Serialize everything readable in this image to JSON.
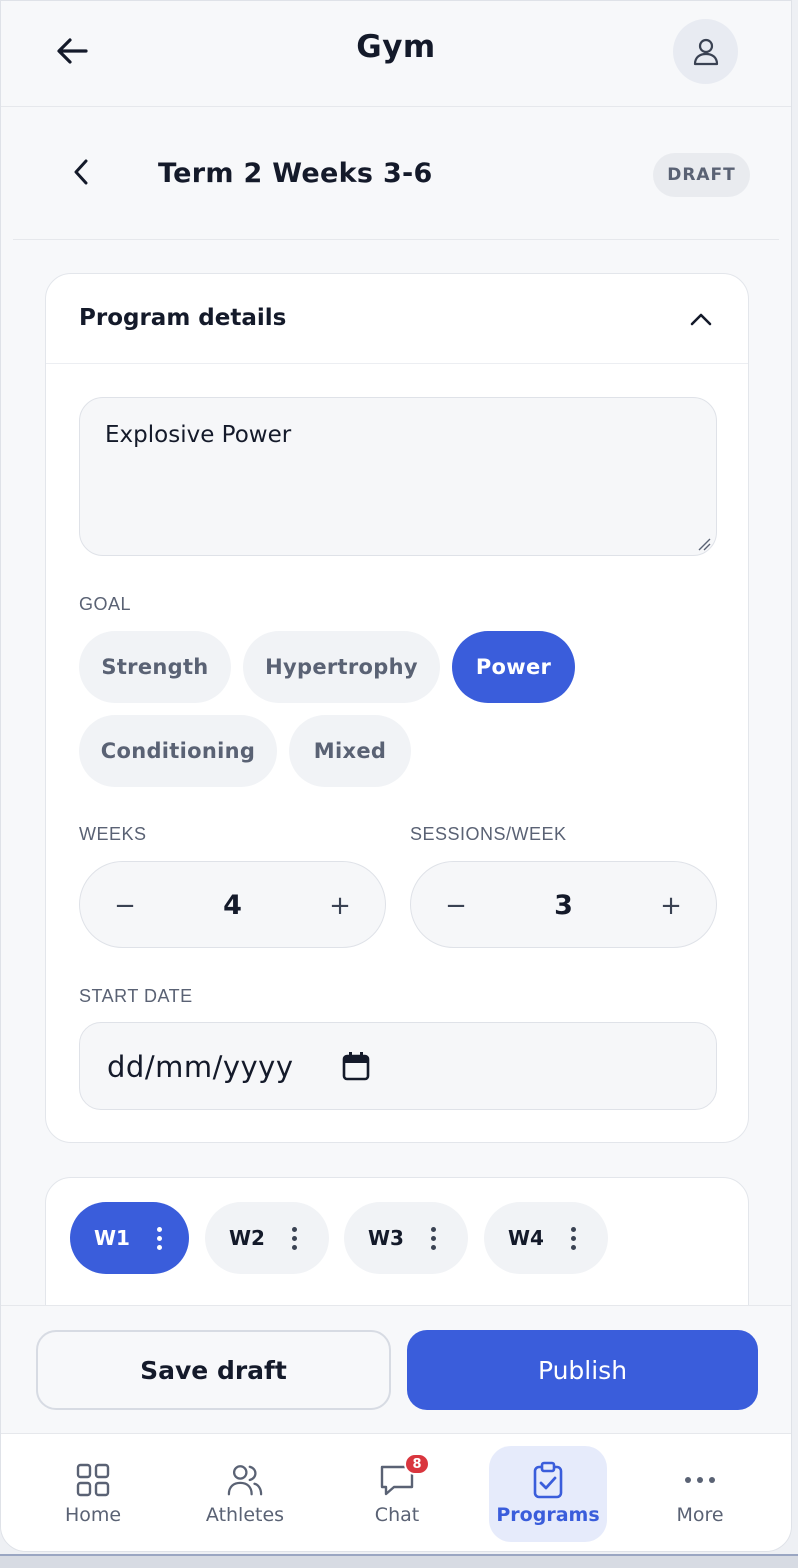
{
  "app": {
    "title": "Gym"
  },
  "program": {
    "title": "Term 2 Weeks 3-6",
    "status": "DRAFT"
  },
  "details": {
    "section_title": "Program details",
    "description": "Explosive Power",
    "goal_label": "GOAL",
    "goals": [
      {
        "label": "Strength",
        "selected": false
      },
      {
        "label": "Hypertrophy",
        "selected": false
      },
      {
        "label": "Power",
        "selected": true
      },
      {
        "label": "Conditioning",
        "selected": false
      },
      {
        "label": "Mixed",
        "selected": false
      }
    ],
    "weeks_label": "WEEKS",
    "weeks_value": "4",
    "sessions_label": "SESSIONS/WEEK",
    "sessions_value": "3",
    "minus_symbol": "−",
    "plus_symbol": "+",
    "start_date_label": "START DATE",
    "start_date_placeholder": "dd/mm/yyyy"
  },
  "week_tabs": [
    {
      "label": "W1",
      "selected": true
    },
    {
      "label": "W2",
      "selected": false
    },
    {
      "label": "W3",
      "selected": false
    },
    {
      "label": "W4",
      "selected": false
    }
  ],
  "actions": {
    "save_label": "Save draft",
    "publish_label": "Publish"
  },
  "nav": {
    "items": [
      {
        "label": "Home",
        "icon": "grid-icon",
        "active": false
      },
      {
        "label": "Athletes",
        "icon": "users-icon",
        "active": false
      },
      {
        "label": "Chat",
        "icon": "chat-icon",
        "active": false
      },
      {
        "label": "Programs",
        "icon": "clipboard-check-icon",
        "active": true
      },
      {
        "label": "More",
        "icon": "more-icon",
        "active": false
      }
    ],
    "chat_badge": "8"
  },
  "colors": {
    "accent": "#3a5ddb",
    "badge": "#d9363e",
    "chip_bg": "#f1f3f6"
  }
}
